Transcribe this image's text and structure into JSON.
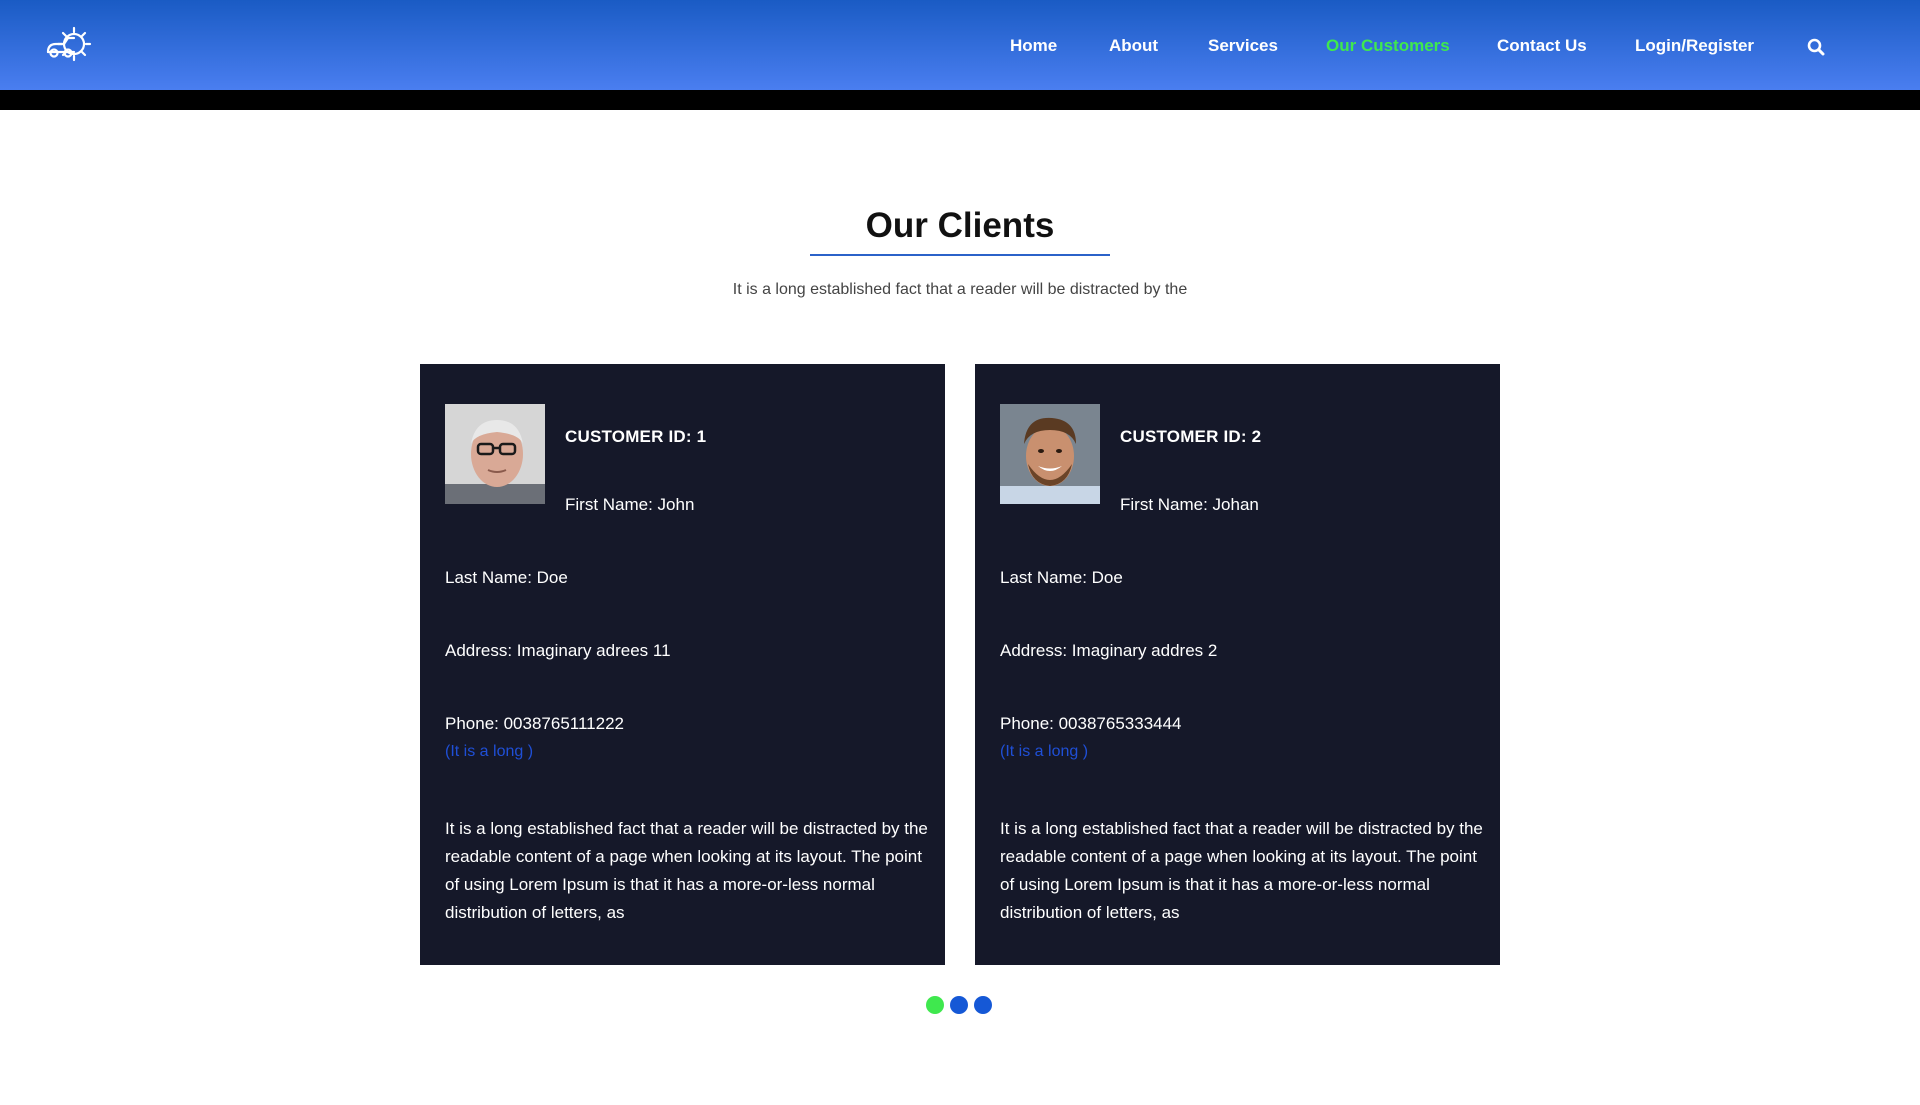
{
  "nav": {
    "items": [
      {
        "label": "Home",
        "active": false
      },
      {
        "label": "About",
        "active": false
      },
      {
        "label": "Services",
        "active": false
      },
      {
        "label": "Our Customers",
        "active": true
      },
      {
        "label": "Contact Us",
        "active": false
      },
      {
        "label": "Login/Register",
        "active": false
      }
    ],
    "logo_icon": "car-gear-icon",
    "search_icon": "search-icon",
    "active_color": "#3fe84e"
  },
  "section": {
    "title": "Our Clients",
    "subtitle": "It is a long established fact that a reader will be distracted by the"
  },
  "customers": [
    {
      "id_label": "CUSTOMER ID: 1",
      "first_name": "First Name: John",
      "last_name": "Last Name: Doe",
      "address": "Address: Imaginary adrees 11",
      "phone": "Phone: 0038765111222",
      "note": "(It is a long )",
      "description": "It is a long established fact that a reader will be distracted by the readable content of a page when looking at its layout. The point of using Lorem Ipsum is that it has a more-or-less normal distribution of letters, as"
    },
    {
      "id_label": "CUSTOMER ID: 2",
      "first_name": "First Name: Johan",
      "last_name": "Last Name: Doe",
      "address": "Address: Imaginary addres 2",
      "phone": "Phone: 0038765333444",
      "note": "(It is a long )",
      "description": "It is a long established fact that a reader will be distracted by the readable content of a page when looking at its layout. The point of using Lorem Ipsum is that it has a more-or-less normal distribution of letters, as"
    }
  ],
  "carousel": {
    "dots": [
      {
        "color": "#3fe84e",
        "active": true
      },
      {
        "color": "#1558d6",
        "active": false
      },
      {
        "color": "#1558d6",
        "active": false
      }
    ]
  },
  "colors": {
    "nav_top": "#1a5bc4",
    "nav_bottom": "#4a7ef0",
    "card_bg": "#151829",
    "link_blue": "#1f4fd6",
    "rule_blue": "#2b62c9"
  }
}
